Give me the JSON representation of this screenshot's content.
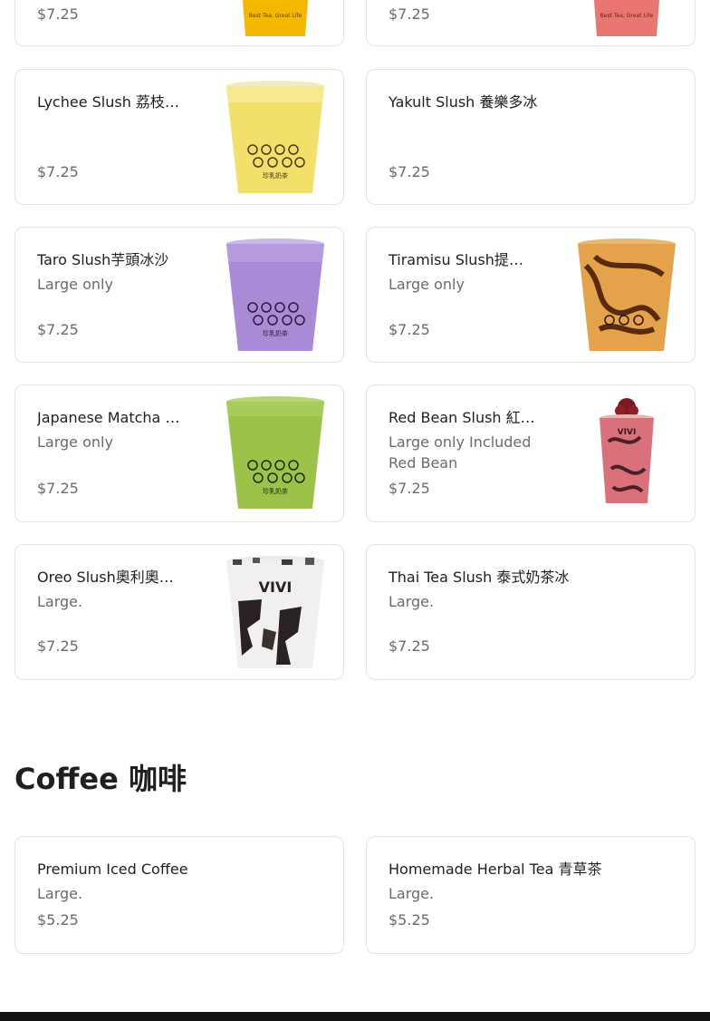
{
  "top_partial": [
    {
      "price": "$7.25",
      "accent": "#f5b800"
    },
    {
      "price": "$7.25",
      "accent": "#e9706c"
    }
  ],
  "slush_items": [
    {
      "name": "Lychee Slush 荔枝冰沙",
      "description": "",
      "price": "$7.25",
      "image": "yellow-slush-cup",
      "color": "#f4e26a"
    },
    {
      "name": "Yakult Slush 養樂多冰",
      "description": "",
      "price": "$7.25",
      "image": null
    },
    {
      "name": "Taro Slush芋頭冰沙",
      "description": "Large only",
      "price": "$7.25",
      "image": "purple-slush-cup",
      "color": "#a98ad6"
    },
    {
      "name": "Tiramisu Slush提拉米蘇冰沙",
      "description": "Large only",
      "price": "$7.25",
      "image": "caramel-slush-cup",
      "color": "#e4a24a"
    },
    {
      "name": "Japanese Matcha Slush 日式抹茶冰沙",
      "description": "Large only",
      "price": "$7.25",
      "image": "green-slush-cup",
      "color": "#9cc24a"
    },
    {
      "name": "Red Bean Slush 紅豆冰沙",
      "description": "Large only Included Red Bean",
      "price": "$7.25",
      "image": "red-bean-slush-cup",
      "color": "#d9707a"
    },
    {
      "name": "Oreo Slush奧利奧冰沙",
      "description": "Large.",
      "price": "$7.25",
      "image": "oreo-slush-cup",
      "color": "#3a3030"
    },
    {
      "name": "Thai Tea Slush 泰式奶茶冰",
      "description": "Large.",
      "price": "$7.25",
      "image": null
    }
  ],
  "cup_text": {
    "brand": "VIVI",
    "tagline": "Best Tea, Great Life",
    "logo": "珍乳奶茶"
  },
  "coffee_section": {
    "title": "Coffee 咖啡",
    "items": [
      {
        "name": "Premium Iced Coffee",
        "description": "Large.",
        "price": "$5.25"
      },
      {
        "name": "Homemade Herbal Tea 青草茶",
        "description": "Large.",
        "price": "$5.25"
      }
    ]
  }
}
